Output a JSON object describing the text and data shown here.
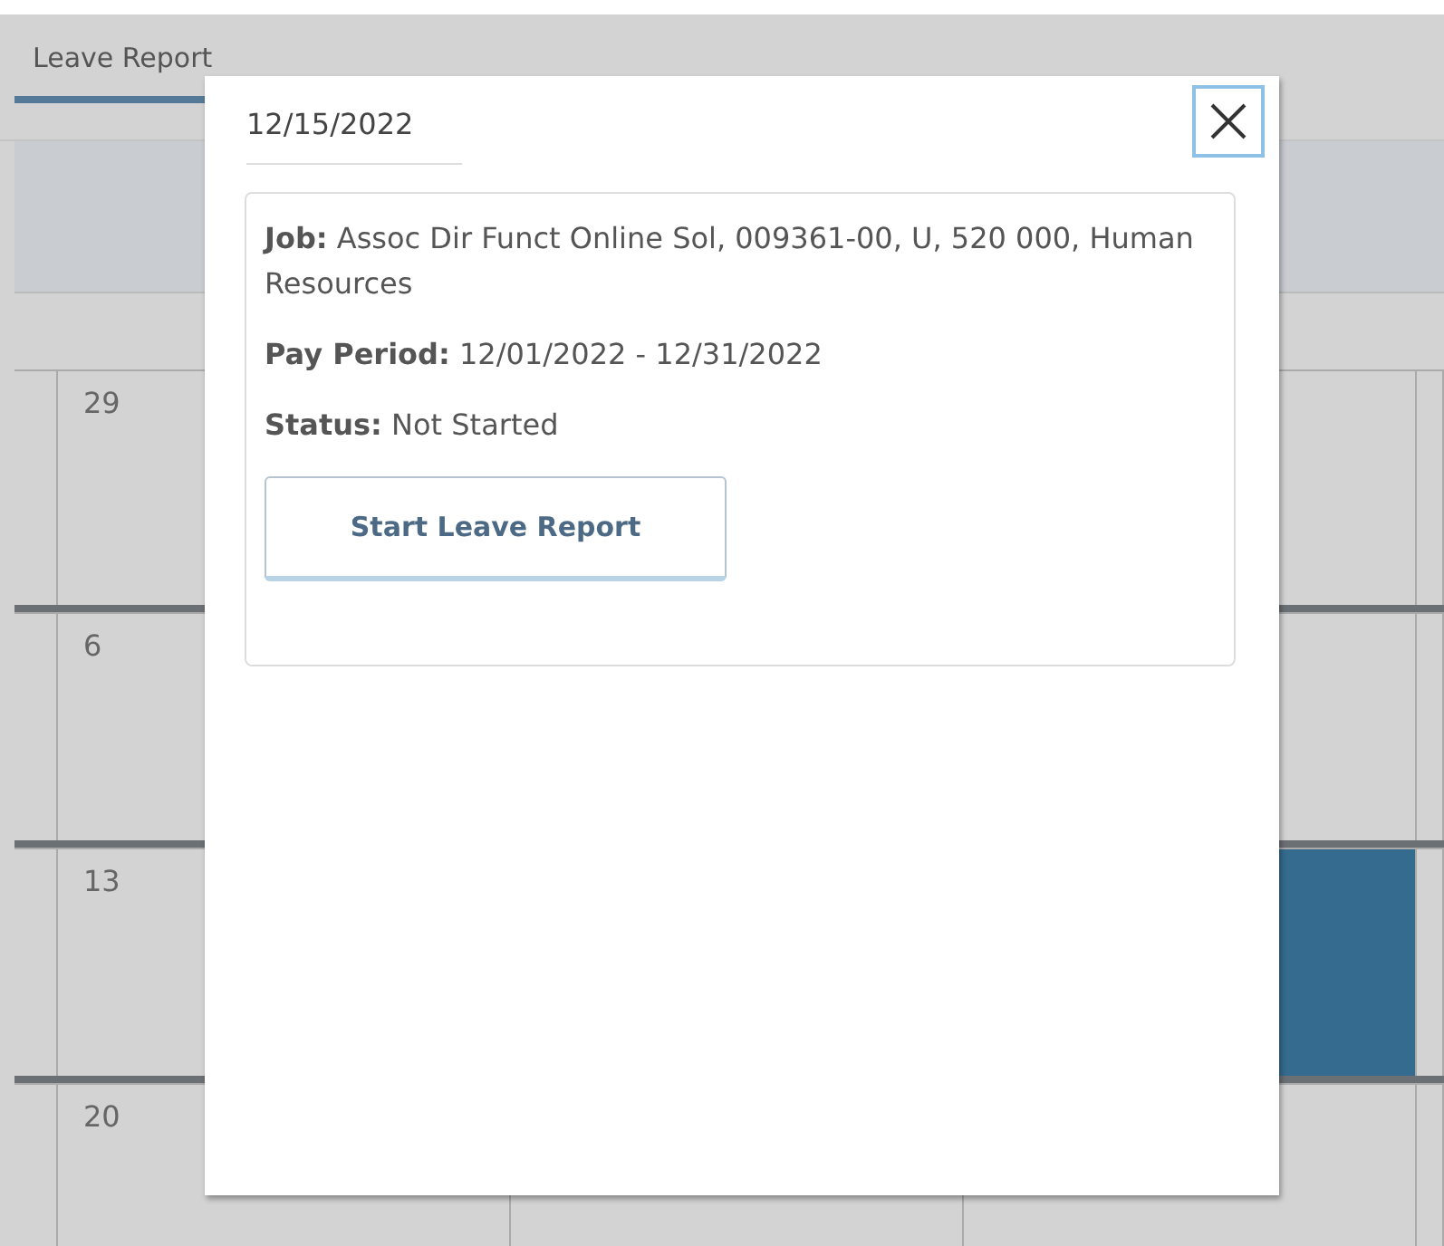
{
  "page": {
    "title": "Leave Report"
  },
  "calendar": {
    "weeks": [
      {
        "first_day": "29",
        "highlighted": false
      },
      {
        "first_day": "6",
        "highlighted": false
      },
      {
        "first_day": "13",
        "highlighted": true
      },
      {
        "first_day": "20",
        "highlighted": false
      }
    ]
  },
  "dialog": {
    "date": "12/15/2022",
    "details": [
      {
        "label": "Job:",
        "value": "Assoc Dir Funct Online Sol, 009361-00, U, 520 000, Human Resources"
      },
      {
        "label": "Pay Period:",
        "value": "12/01/2022 - 12/31/2022"
      },
      {
        "label": "Status:",
        "value": "Not Started"
      }
    ],
    "button": "Start Leave Report"
  }
}
